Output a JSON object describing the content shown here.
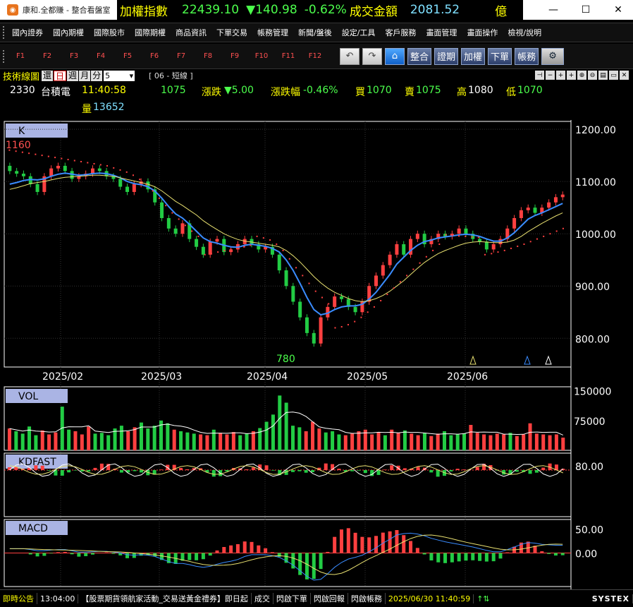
{
  "titlebar": {
    "app_title": "康和.全都賺 - 整合看盤室",
    "index_label": "加權指數",
    "index_value": "22439.10",
    "index_change": "▼140.98",
    "index_pct": "-0.62%",
    "turnover_label": "成交金額",
    "turnover_value": "2081.52",
    "turnover_unit": "億",
    "btn_minimize": "—",
    "btn_maximize": "☐",
    "btn_close": "✕"
  },
  "menu": [
    "國內證券",
    "國內期權",
    "國際股市",
    "國際期權",
    "商品資訊",
    "下單交易",
    "帳務管理",
    "新聞/盤後",
    "設定/工具",
    "客戶服務",
    "畫面管理",
    "畫面操作",
    "檢視/說明"
  ],
  "toolbar": {
    "fkeys": [
      "F1",
      "F2",
      "F3",
      "F4",
      "F5",
      "F6",
      "F7",
      "F8",
      "F9",
      "F10",
      "F11",
      "F12"
    ],
    "buttons": [
      "整合",
      "證期",
      "加權",
      "下單",
      "帳務"
    ],
    "undo_glyph": "↶",
    "redo_glyph": "↷",
    "home_glyph": "⌂",
    "gear_glyph": "⚙"
  },
  "chart_header": {
    "tag": "技術線圖",
    "periods": [
      "還",
      "日",
      "週",
      "月",
      "分"
    ],
    "active_period": "日",
    "minute_value": "5",
    "mode": "[ 06 - 短線 ]",
    "tools": [
      "⊣",
      "−",
      "+",
      "+",
      "⊕",
      "⊖",
      "▤",
      "▭",
      "✕"
    ]
  },
  "quote": {
    "code": "2330",
    "name": "台積電",
    "time": "11:40:58",
    "price": "1075",
    "change_label": "漲跌",
    "change": "▼5.00",
    "pct_label": "漲跌幅",
    "pct": "-0.46%",
    "bid_label": "買",
    "bid": "1070",
    "ask_label": "賣",
    "ask": "1075",
    "high_label": "高",
    "high": "1080",
    "low_label": "低",
    "low": "1070",
    "vol_label": "量",
    "volume": "13652"
  },
  "chart_data": [
    {
      "type": "line",
      "panel": "K",
      "title": "K",
      "y_ticks": [
        "1200.00",
        "1100.00",
        "1000.00",
        "900.00",
        "800.00"
      ],
      "ylim": [
        745,
        1215
      ],
      "x_ticks": [
        "2025/02",
        "2025/03",
        "2025/04",
        "2025/05",
        "2025/06"
      ],
      "annotations": {
        "max": "1160",
        "min": "780"
      },
      "close": [
        1120,
        1115,
        1110,
        1095,
        1080,
        1110,
        1125,
        1130,
        1120,
        1105,
        1110,
        1115,
        1125,
        1120,
        1110,
        1105,
        1090,
        1080,
        1095,
        1100,
        1085,
        1060,
        1030,
        1010,
        1000,
        1020,
        990,
        975,
        960,
        985,
        990,
        965,
        970,
        980,
        990,
        980,
        970,
        975,
        960,
        930,
        900,
        870,
        840,
        810,
        790,
        840,
        860,
        880,
        875,
        860,
        850,
        870,
        900,
        920,
        940,
        960,
        980,
        960,
        990,
        1000,
        980,
        990,
        1000,
        995,
        1000,
        1010,
        1000,
        990,
        985,
        970,
        980,
        990,
        1010,
        1030,
        1045,
        1050,
        1040,
        1050,
        1060,
        1070,
        1075
      ],
      "ma_short": [
        1095,
        1098,
        1102,
        1104,
        1103,
        1105,
        1110,
        1114,
        1116,
        1114,
        1112,
        1113,
        1115,
        1116,
        1115,
        1112,
        1107,
        1100,
        1096,
        1094,
        1090,
        1082,
        1068,
        1052,
        1038,
        1030,
        1018,
        1005,
        992,
        985,
        982,
        978,
        975,
        974,
        978,
        980,
        978,
        976,
        972,
        965,
        950,
        930,
        905,
        878,
        855,
        845,
        848,
        855,
        860,
        862,
        862,
        865,
        875,
        888,
        905,
        922,
        942,
        955,
        968,
        978,
        985,
        988,
        992,
        994,
        996,
        998,
        999,
        998,
        995,
        990,
        986,
        986,
        992,
        1002,
        1015,
        1028,
        1035,
        1040,
        1046,
        1052,
        1058
      ],
      "ma_mid": [
        1085,
        1088,
        1092,
        1096,
        1098,
        1100,
        1103,
        1106,
        1108,
        1109,
        1110,
        1111,
        1112,
        1112,
        1111,
        1110,
        1107,
        1104,
        1101,
        1098,
        1095,
        1090,
        1082,
        1072,
        1062,
        1054,
        1045,
        1036,
        1025,
        1016,
        1008,
        1000,
        994,
        989,
        986,
        984,
        982,
        980,
        978,
        975,
        968,
        958,
        946,
        932,
        918,
        906,
        896,
        888,
        882,
        876,
        872,
        870,
        872,
        876,
        882,
        890,
        900,
        910,
        922,
        934,
        945,
        954,
        962,
        968,
        973,
        978,
        982,
        984,
        985,
        984,
        983,
        983,
        984,
        988,
        995,
        1004,
        1012,
        1020,
        1027,
        1034,
        1040
      ],
      "sar": [
        1160,
        1158,
        1156,
        1154,
        1152,
        1150,
        1148,
        1146,
        1144,
        1142,
        1140,
        1138,
        1136,
        1134,
        1132,
        1130,
        1126,
        1122,
        1118,
        1112,
        1104,
        1094,
        1082,
        1068,
        1054,
        1040,
        1028,
        1016,
        1005,
        995,
        960,
        962,
        965,
        968,
        970,
        972,
        975,
        978,
        995,
        992,
        988,
        980,
        968,
        952,
        935,
        920,
        905,
        890,
        878,
        866,
        820,
        822,
        826,
        832,
        840,
        850,
        860,
        872,
        884,
        896,
        908,
        920,
        932,
        944,
        956,
        968,
        980,
        998,
        997,
        996,
        995,
        994,
        993,
        960,
        962,
        965,
        968,
        972,
        976,
        980,
        985,
        990,
        995,
        1000,
        1005,
        1010
      ]
    },
    {
      "type": "bar",
      "panel": "VOL",
      "title": "VOL",
      "y_ticks": [
        "150000",
        "75000"
      ],
      "ylim": [
        0,
        160000
      ],
      "values": [
        55000,
        48000,
        42000,
        60000,
        38000,
        50000,
        40000,
        45000,
        110000,
        52000,
        48000,
        40000,
        60000,
        42000,
        44000,
        38000,
        55000,
        62000,
        48000,
        58000,
        70000,
        55000,
        62000,
        75000,
        68000,
        52000,
        48000,
        45000,
        42000,
        40000,
        38000,
        52000,
        44000,
        40000,
        46000,
        38000,
        42000,
        48000,
        56000,
        72000,
        90000,
        138000,
        120000,
        62000,
        58000,
        48000,
        72000,
        55000,
        45000,
        48000,
        40000,
        38000,
        42000,
        48000,
        52000,
        40000,
        46000,
        38000,
        52000,
        44000,
        50000,
        42000,
        38000,
        44000,
        36000,
        42000,
        48000,
        38000,
        40000,
        42000,
        64000,
        44000,
        40000,
        38000,
        42000,
        40000,
        44000,
        36000,
        40000,
        68000,
        42000,
        40000,
        38000,
        40000,
        32000
      ]
    },
    {
      "type": "line",
      "panel": "KDFAST",
      "title": "KDFAST",
      "y_ticks": [
        "80.00"
      ],
      "ylim": [
        0,
        100
      ]
    },
    {
      "type": "bar",
      "panel": "MACD",
      "title": "MACD",
      "y_ticks": [
        "50.00",
        "0.00"
      ],
      "ylim": [
        -70,
        70
      ]
    }
  ],
  "status": {
    "label": "即時公告",
    "time": "13:04:00",
    "news": "【股票期貨領航家活動_交易送黃金禮券】即日起",
    "items": [
      "成交",
      "閃啟下單",
      "閃啟回報",
      "閃啟帳務"
    ],
    "clock": "2025/06/30 11:40:59",
    "brand": "SYSTEX"
  },
  "colors": {
    "up": "#ff4040",
    "down": "#22cc44",
    "ma_short": "#3a8cff",
    "ma_mid": "#e8e070",
    "sar": "#ff4040",
    "accent_yellow": "#ffff00"
  }
}
